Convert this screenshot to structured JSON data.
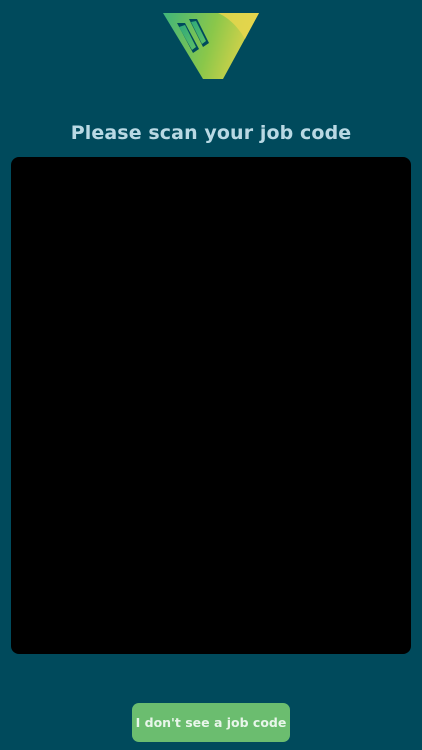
{
  "header": {
    "logo_icon": "v-logo-icon",
    "logo_colors": [
      "#3fb57a",
      "#8ac74a",
      "#e2d44a"
    ]
  },
  "main": {
    "title": "Please scan your job code"
  },
  "actions": {
    "no_code_label": "I don't see a job code",
    "no_code_color": "#6bbd6f"
  },
  "theme": {
    "background": "#004a5c",
    "camera_background": "#000000"
  }
}
